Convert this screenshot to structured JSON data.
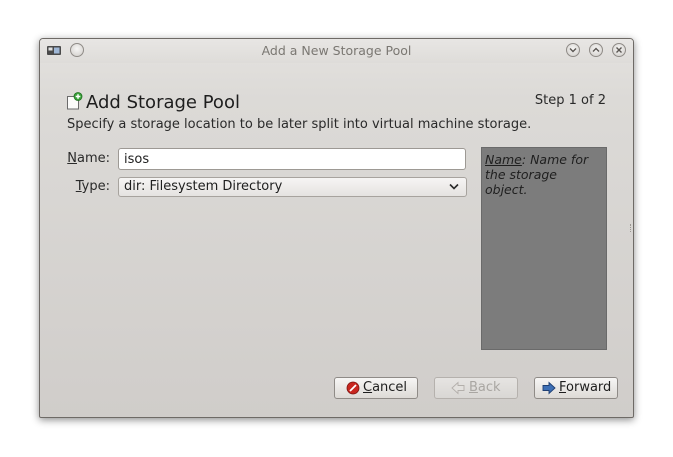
{
  "window": {
    "title": "Add a New Storage Pool"
  },
  "header": {
    "title": "Add Storage Pool",
    "step": "Step 1 of 2",
    "subtitle": "Specify a storage location to be later split into virtual machine storage."
  },
  "form": {
    "name_label_mnemonic": "N",
    "name_label_rest": "ame:",
    "name_value": "isos",
    "type_label_mnemonic": "T",
    "type_label_rest": "ype:",
    "type_value": "dir: Filesystem Directory"
  },
  "help": {
    "term": "Name",
    "text": ": Name for the storage object."
  },
  "buttons": {
    "cancel_mnemonic": "C",
    "cancel_rest": "ancel",
    "back_mnemonic": "B",
    "back_rest": "ack",
    "forward_mnemonic": "F",
    "forward_rest": "orward"
  },
  "icons": {
    "app": "virt-manager-icon",
    "header": "add-document-icon",
    "cancel": "stop-icon",
    "back": "arrow-left-icon",
    "forward": "arrow-right-icon"
  },
  "colors": {
    "window_bg": "#dcdad7",
    "help_panel_bg": "#7c7c7c",
    "cancel_icon": "#c8261f",
    "forward_icon": "#3d6fb5"
  }
}
